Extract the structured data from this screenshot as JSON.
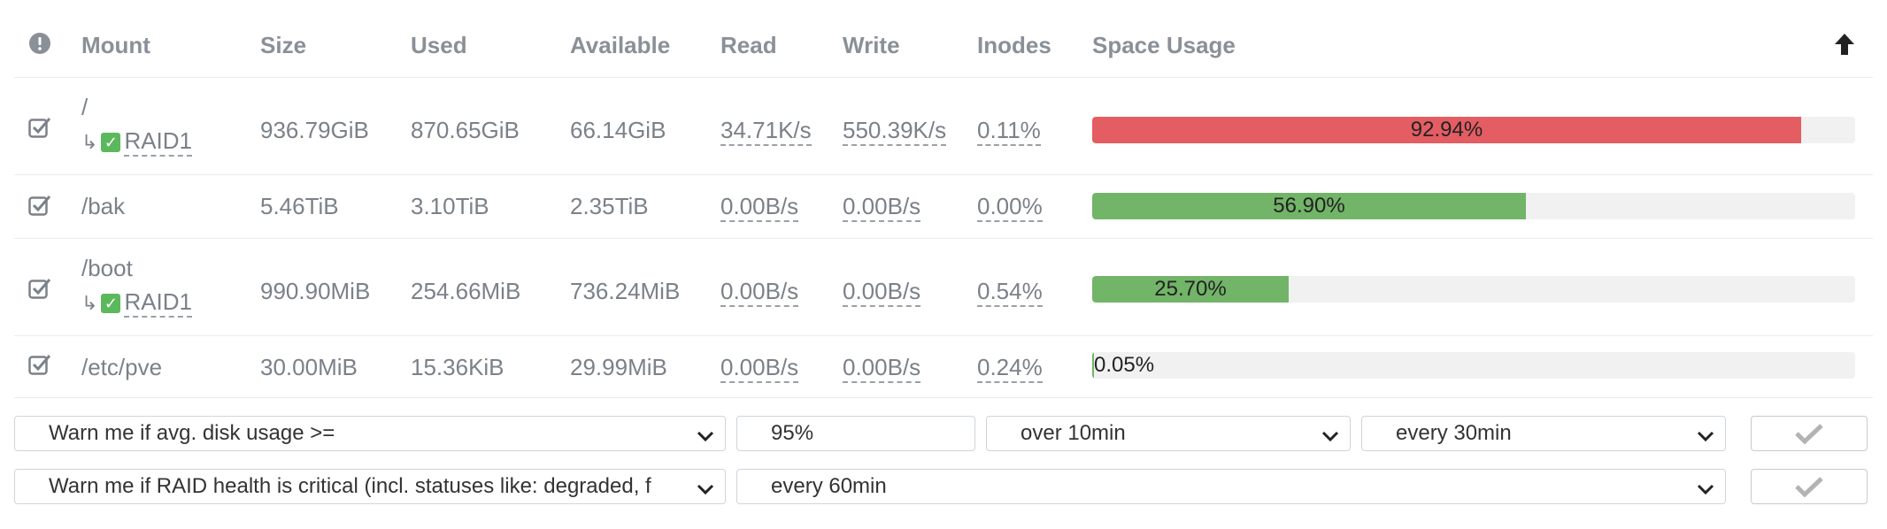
{
  "header": {
    "mount": "Mount",
    "size": "Size",
    "used": "Used",
    "available": "Available",
    "read": "Read",
    "write": "Write",
    "inodes": "Inodes",
    "space_usage": "Space Usage"
  },
  "rows": [
    {
      "mount": "/",
      "raid": "RAID1",
      "size": "936.79GiB",
      "used": "870.65GiB",
      "available": "66.14GiB",
      "read": "34.71K/s",
      "write": "550.39K/s",
      "inodes": "0.11%",
      "usage_label": "92.94%",
      "usage_fraction": 0.9294,
      "bar_color": "#e35d63"
    },
    {
      "mount": "/bak",
      "size": "5.46TiB",
      "used": "3.10TiB",
      "available": "2.35TiB",
      "read": "0.00B/s",
      "write": "0.00B/s",
      "inodes": "0.00%",
      "usage_label": "56.90%",
      "usage_fraction": 0.569,
      "bar_color": "#72b468"
    },
    {
      "mount": "/boot",
      "raid": "RAID1",
      "size": "990.90MiB",
      "used": "254.66MiB",
      "available": "736.24MiB",
      "read": "0.00B/s",
      "write": "0.00B/s",
      "inodes": "0.54%",
      "usage_label": "25.70%",
      "usage_fraction": 0.257,
      "bar_color": "#72b468"
    },
    {
      "mount": "/etc/pve",
      "size": "30.00MiB",
      "used": "15.36KiB",
      "available": "29.99MiB",
      "read": "0.00B/s",
      "write": "0.00B/s",
      "inodes": "0.24%",
      "usage_label": "0.05%",
      "usage_fraction": 0.0005,
      "bar_color": "#72b468"
    }
  ],
  "alerts": {
    "disk_usage_condition": "Warn me if avg. disk usage >=",
    "disk_usage_threshold": "95%",
    "disk_usage_period": "over 10min",
    "disk_usage_frequency": "every 30min",
    "raid_condition": "Warn me if RAID health is critical (incl. statuses like: degraded, f",
    "raid_frequency": "every 60min"
  },
  "icons": {
    "header_alert": "exclamation-circle-icon",
    "sort": "arrow-up-icon",
    "row_check": "checked-box-icon",
    "raid_ok": "check-square-icon",
    "raid_arrow": "turn-right-arrow-icon",
    "dropdown": "chevron-down-icon",
    "confirm": "checkmark-icon"
  }
}
